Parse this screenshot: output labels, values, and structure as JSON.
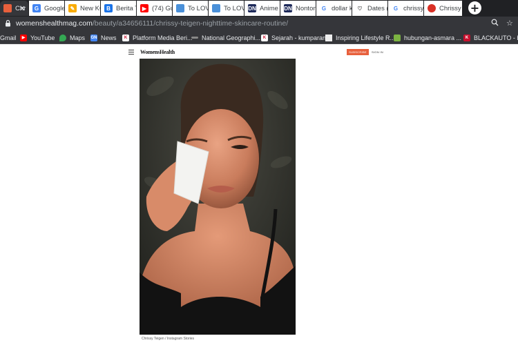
{
  "browser": {
    "tabs": [
      {
        "title": "Chr",
        "favicon": "womenshealth-icon",
        "color": "#e8603c",
        "active": true
      },
      {
        "title": "Google",
        "favicon": "google-translate-icon",
        "color": "#4285f4",
        "active": false
      },
      {
        "title": "New KC",
        "favicon": "pencil-icon",
        "color": "#f9ab00",
        "active": false
      },
      {
        "title": "Berita T",
        "favicon": "berita-icon",
        "color": "#1a73e8",
        "active": false
      },
      {
        "title": "(74) Gu",
        "favicon": "youtube-icon",
        "color": "#ff0000",
        "active": false
      },
      {
        "title": "To LOV",
        "favicon": "doc-icon",
        "color": "#4a90d9",
        "active": false
      },
      {
        "title": "To LOV",
        "favicon": "doc-icon",
        "color": "#4a90d9",
        "active": false
      },
      {
        "title": "Anime",
        "favicon": "dn-icon",
        "color": "#1e2a5a",
        "active": false
      },
      {
        "title": "Nonton",
        "favicon": "dn-icon",
        "color": "#1e2a5a",
        "active": false
      },
      {
        "title": "dollar k",
        "favicon": "google-icon",
        "color": "#4285f4",
        "active": false
      },
      {
        "title": "Dates (",
        "favicon": "heart-icon",
        "color": "#333333",
        "active": false
      },
      {
        "title": "chrissy",
        "favicon": "google-icon",
        "color": "#4285f4",
        "active": false
      },
      {
        "title": "Chrissy",
        "favicon": "red-icon",
        "color": "#d93025",
        "active": false
      }
    ],
    "new_tab_label": "+",
    "url_host": "womenshealthmag.com",
    "url_path": "/beauty/a34656111/chrissy-teigen-nighttime-skincare-routine/"
  },
  "bookmarks": [
    {
      "label": "Gmail",
      "favicon": "gmail-icon",
      "color": "#ea4335"
    },
    {
      "label": "YouTube",
      "favicon": "youtube-icon",
      "color": "#ff0000"
    },
    {
      "label": "Maps",
      "favicon": "maps-icon",
      "color": "#34a853"
    },
    {
      "label": "News",
      "favicon": "news-icon",
      "color": "#4285f4"
    },
    {
      "label": "Platform Media Beri...",
      "favicon": "platform-icon",
      "color": "#c8102e"
    },
    {
      "label": "National Geographi...",
      "favicon": "natgeo-icon",
      "color": "#888888"
    },
    {
      "label": "Sejarah - kumparan",
      "favicon": "kumparan-icon",
      "color": "#c8102e"
    },
    {
      "label": "Inspiring Lifestyle R...",
      "favicon": "lifestyle-icon",
      "color": "#eeeeee"
    },
    {
      "label": "hubungan-asmara ...",
      "favicon": "hubungan-icon",
      "color": "#7cb342"
    },
    {
      "label": "BLACKAUTO - blac",
      "favicon": "blackauto-icon",
      "color": "#c8102e"
    }
  ],
  "site": {
    "logo": "WomensHealth",
    "subscribe": "SUBSCRIBE",
    "sign_in": "SIGN IN",
    "photo_caption": "Chrissy Teigen / Instagram Stories"
  }
}
